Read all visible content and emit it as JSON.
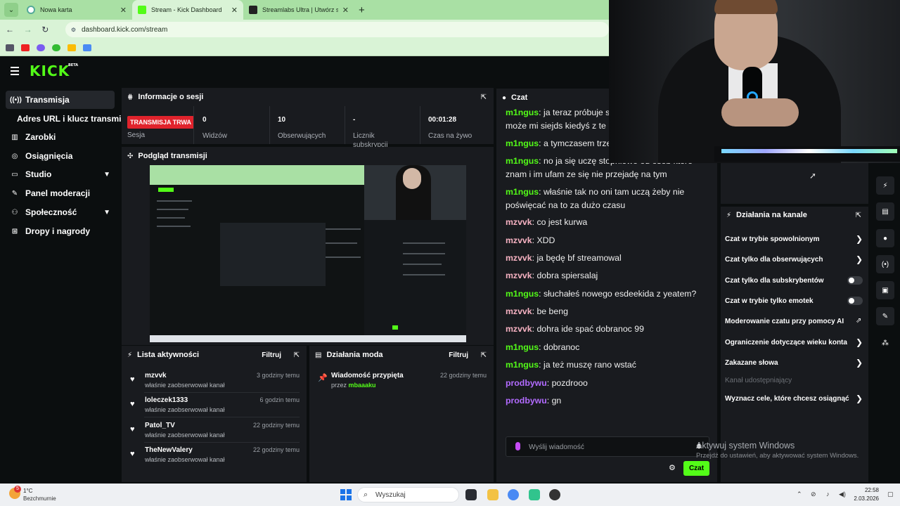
{
  "browser": {
    "tabs": [
      {
        "title": "Nowa karta",
        "color": "#ffffff"
      },
      {
        "title": "Stream - Kick Dashboard",
        "color": "#53fc18"
      },
      {
        "title": "Streamlabs Ultra | Utwórz subsk",
        "color": "#222222"
      }
    ],
    "url": "dashboard.kick.com/stream"
  },
  "sidebar": {
    "items": [
      {
        "label": "Transmisja",
        "icon": "broadcast-icon"
      },
      {
        "label": "Zarobki",
        "icon": "earnings-icon"
      },
      {
        "label": "Osiągnięcia",
        "icon": "achievements-icon"
      },
      {
        "label": "Studio",
        "icon": "studio-icon"
      },
      {
        "label": "Panel moderacji",
        "icon": "wrench-icon"
      },
      {
        "label": "Społeczność",
        "icon": "community-icon"
      },
      {
        "label": "Dropy i nagrody",
        "icon": "drops-icon"
      }
    ],
    "sub_item": "Adres URL i klucz transmisji"
  },
  "session": {
    "title": "Informacje o sesji",
    "live_badge": "TRANSMISJA TRWA",
    "session_label": "Sesja",
    "stats": [
      {
        "value": "0",
        "label": "Widzów"
      },
      {
        "value": "10",
        "label": "Obserwujących"
      },
      {
        "value": "-",
        "label": "Licznik subskrypcji"
      },
      {
        "value": "00:01:28",
        "label": "Czas na żywo"
      }
    ]
  },
  "preview": {
    "title": "Podgląd transmisji"
  },
  "chat": {
    "title": "Czat",
    "messages": [
      {
        "user": "m1ngus",
        "color": "#53fc18",
        "text": "ja teraz próbuje s",
        "cont": "może mi siejds kiedyś z te"
      },
      {
        "user": "m1ngus",
        "color": "#53fc18",
        "text": "a tymczasem trze",
        "cont": ""
      },
      {
        "user": "m1ngus",
        "color": "#53fc18",
        "text": "no ja się uczę stopniowo od osób które",
        "cont": "znam i im ufam ze się nie przejadę na tym"
      },
      {
        "user": "m1ngus",
        "color": "#53fc18",
        "text": "właśnie tak no oni tam uczą żeby nie",
        "cont": "poświęcać na to za dużo czasu"
      },
      {
        "user": "mzvvk",
        "color": "#f6b2c2",
        "text": "co jest kurwa",
        "cont": ""
      },
      {
        "user": "mzvvk",
        "color": "#f6b2c2",
        "text": "XDD",
        "cont": ""
      },
      {
        "user": "mzvvk",
        "color": "#f6b2c2",
        "text": "ja będę bf streamowal",
        "cont": ""
      },
      {
        "user": "mzvvk",
        "color": "#f6b2c2",
        "text": "dobra spiersalaj",
        "cont": ""
      },
      {
        "user": "m1ngus",
        "color": "#53fc18",
        "text": "słuchałeś nowego esdeekida z yeatem?",
        "cont": ""
      },
      {
        "user": "mzvvk",
        "color": "#f6b2c2",
        "text": "be beng",
        "cont": ""
      },
      {
        "user": "mzvvk",
        "color": "#f6b2c2",
        "text": "dohra ide spać dobranoc 99",
        "cont": ""
      },
      {
        "user": "m1ngus",
        "color": "#53fc18",
        "text": "dobranoc",
        "cont": ""
      },
      {
        "user": "m1ngus",
        "color": "#53fc18",
        "text": "ja też muszę rano wstać",
        "cont": ""
      },
      {
        "user": "prodbywu",
        "color": "#b26bff",
        "text": "pozdrooo",
        "cont": ""
      },
      {
        "user": "prodbywu",
        "color": "#b26bff",
        "text": "gn",
        "cont": ""
      }
    ],
    "input_placeholder": "Wyślij wiadomość",
    "send_label": "Czat"
  },
  "activity": {
    "title": "Lista aktywności",
    "filter_label": "Filtruj",
    "items": [
      {
        "name": "mzvvk",
        "sub": "właśnie zaobserwował kanał",
        "time": "3 godziny temu"
      },
      {
        "name": "loleczek1333",
        "sub": "właśnie zaobserwował kanał",
        "time": "6 godzin temu"
      },
      {
        "name": "Patol_TV",
        "sub": "właśnie zaobserwował kanał",
        "time": "22 godziny temu"
      },
      {
        "name": "TheNewValery",
        "sub": "właśnie zaobserwował kanał",
        "time": "22 godziny temu"
      }
    ]
  },
  "mod": {
    "title": "Działania moda",
    "filter_label": "Filtruj",
    "item": {
      "name": "Wiadomość przypięta",
      "by_prefix": "przez",
      "by_user": "mbaaaku",
      "time": "22 godziny temu"
    }
  },
  "channel_actions": {
    "title": "Działania na kanale",
    "items": [
      {
        "label": "Czat w trybie spowolnionym",
        "control": "chevron"
      },
      {
        "label": "Czat tylko dla obserwujących",
        "control": "chevron"
      },
      {
        "label": "Czat tylko dla subskrybentów",
        "control": "toggle",
        "enabled": false
      },
      {
        "label": "Czat w trybie tylko emotek",
        "control": "toggle",
        "enabled": false
      },
      {
        "label": "Moderowanie czatu przy pomocy AI",
        "control": "external"
      },
      {
        "label": "Ograniczenie dotyczące wieku konta",
        "control": "chevron"
      },
      {
        "label": "Zakazane słowa",
        "control": "chevron"
      },
      {
        "label": "Kanał udostępniający",
        "control": "disabled"
      },
      {
        "label": "Wyznacz cele, które chcesz osiągnąć",
        "control": "chevron"
      }
    ]
  },
  "watermark": {
    "line1": "Aktywuj system Windows",
    "line2": "Przejdź do ustawień, aby aktywować system Windows."
  },
  "taskbar": {
    "badge": "5",
    "temperature": "1°C",
    "condition": "Bezchmurnie",
    "search": "Wyszukaj",
    "time": "22:58",
    "date": "2.03.2026"
  },
  "colors": {
    "accent": "#53fc18",
    "live": "#e0232c",
    "panel": "#191b1f",
    "background": "#0b0e0f"
  }
}
